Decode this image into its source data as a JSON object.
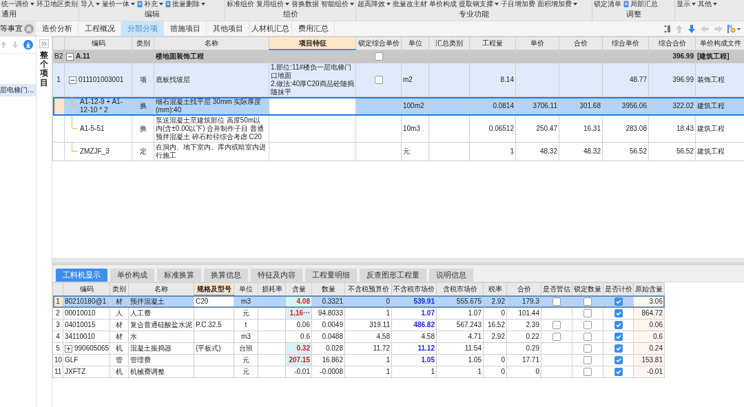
{
  "ribbon": {
    "groups": [
      {
        "label": "通用",
        "buttons": [
          {
            "label": "统一调价",
            "dropdown": true
          },
          {
            "label": "环卫地区类别",
            "dropdown": false
          }
        ]
      },
      {
        "label": "编辑",
        "buttons": [
          {
            "label": "导入",
            "dropdown": true
          },
          {
            "label": "量价一体",
            "dropdown": true
          },
          {
            "label": "补充",
            "dropdown": true,
            "icon": true
          },
          {
            "label": "批量删除",
            "dropdown": true,
            "icon": true
          }
        ]
      },
      {
        "label": "组价",
        "buttons": [
          {
            "label": "标准组价",
            "dropdown": false
          },
          {
            "label": "复用组价",
            "dropdown": true
          },
          {
            "label": "替换数据",
            "dropdown": false
          },
          {
            "label": "智能组价",
            "dropdown": true
          }
        ]
      },
      {
        "label": "专业功能",
        "buttons": [
          {
            "label": "超高降效",
            "dropdown": true
          },
          {
            "label": "批量改主材",
            "dropdown": false
          },
          {
            "label": "单价构成",
            "dropdown": false
          },
          {
            "label": "提取钢支撑",
            "dropdown": true
          },
          {
            "label": "子目增加费",
            "dropdown": false
          },
          {
            "label": "面积增加费",
            "dropdown": true
          }
        ]
      },
      {
        "label": "调整",
        "buttons": [
          {
            "label": "锁定清单",
            "dropdown": false
          },
          {
            "label": "局部汇总",
            "dropdown": false,
            "icon": true
          }
        ]
      },
      {
        "buttons": [
          {
            "label": "显示",
            "dropdown": true
          },
          {
            "label": "其他",
            "dropdown": true
          }
        ]
      }
    ]
  },
  "sidebar": {
    "title": "等事宜",
    "items": [
      {
        "label": "层电梯门...",
        "selected": true
      }
    ]
  },
  "project_strip": {
    "label": "整个项目"
  },
  "tabs": [
    {
      "label": "造价分析",
      "selected": false
    },
    {
      "label": "工程概况",
      "selected": false
    },
    {
      "label": "分部分项",
      "selected": true
    },
    {
      "label": "措施项目",
      "selected": false
    },
    {
      "label": "其他项目",
      "selected": false
    },
    {
      "label": "人材机汇总",
      "selected": false
    },
    {
      "label": "费用汇总",
      "selected": false
    }
  ],
  "items_table": {
    "columns": [
      {
        "label": "编码",
        "selected": false
      },
      {
        "label": "类别",
        "selected": false
      },
      {
        "label": "名称",
        "selected": false
      },
      {
        "label": "项目特征",
        "selected": true
      },
      {
        "label": "锁定综合单价",
        "selected": false
      },
      {
        "label": "单位",
        "selected": false
      },
      {
        "label": "汇总类别",
        "selected": false
      },
      {
        "label": "工程量",
        "selected": false
      },
      {
        "label": "单价",
        "selected": false
      },
      {
        "label": "合价",
        "selected": false
      },
      {
        "label": "综合单价",
        "selected": false
      },
      {
        "label": "综合合价",
        "selected": false
      },
      {
        "label": "单价构成文件",
        "selected": false
      }
    ],
    "rows": [
      {
        "kind": "section",
        "number": "B2",
        "code": "A.11",
        "name": "楼地面装饰工程",
        "locked": false,
        "expanded": true,
        "selected": false,
        "comp_total": "396.99",
        "file": "[建筑工程]",
        "children": [
          {
            "kind": "item",
            "number": "1",
            "code": "011101003001",
            "type": "项",
            "name": "底板找坡层",
            "features": [
              "1.部位:11#楼负一层电梯门口地面",
              "2.做法:40厚C20商品砼随捣随抹平"
            ],
            "locked": false,
            "expanded": true,
            "selected": false,
            "unit": "m2",
            "quantity": "8.14",
            "comp_unit_price": "48.77",
            "comp_total": "396.99",
            "file": "装饰工程",
            "children": [
              {
                "kind": "sub",
                "code": "A1-12-9 + A1-12-10 * 2",
                "type": "换",
                "name": "细石混凝土找平层 30mm  实际厚度(mm):40",
                "selected": true,
                "unit": "100m2",
                "quantity": "0.0814",
                "unit_price": "3706.11",
                "price": "301.68",
                "comp_unit_price": "3956.06",
                "comp_total": "322.02",
                "file": "建筑工程"
              },
              {
                "kind": "sub",
                "code": "A1-5-51",
                "type": "换",
                "name": "泵送混凝土至建筑部位 高度50m以内(含±0.00以下)  合并制作子目 普通预拌混凝土 碎石粒径综合考虑 C20",
                "selected": false,
                "unit": "10m3",
                "quantity": "0.06512",
                "unit_price": "250.47",
                "price": "16.31",
                "comp_unit_price": "283.08",
                "comp_total": "18.43",
                "file": "建筑工程"
              },
              {
                "kind": "sub",
                "code": "ZMZJF_3",
                "type": "定",
                "name": "在洞内、地下室内、库内或暗室内进行施工",
                "selected": false,
                "unit": "元",
                "quantity": "1",
                "unit_price": "48.32",
                "price": "48.32",
                "comp_unit_price": "56.52",
                "comp_total": "56.52",
                "file": "建筑工程"
              }
            ]
          }
        ]
      }
    ]
  },
  "detail_tabs": [
    {
      "label": "工料机显示",
      "selected": true
    },
    {
      "label": "单价构成",
      "selected": false
    },
    {
      "label": "标准换算",
      "selected": false
    },
    {
      "label": "换算信息",
      "selected": false
    },
    {
      "label": "特征及内容",
      "selected": false
    },
    {
      "label": "工程量明细",
      "selected": false
    },
    {
      "label": "反查图形工程量",
      "selected": false
    },
    {
      "label": "说明信息",
      "selected": false
    }
  ],
  "resources_table": {
    "columns": [
      {
        "label": "编码",
        "selected": false
      },
      {
        "label": "类别",
        "selected": false
      },
      {
        "label": "名称",
        "selected": false
      },
      {
        "label": "规格及型号",
        "selected": true
      },
      {
        "label": "单位",
        "selected": false
      },
      {
        "label": "损耗率",
        "selected": false
      },
      {
        "label": "含量",
        "selected": false
      },
      {
        "label": "数量",
        "selected": false
      },
      {
        "label": "不含税预算价",
        "selected": false
      },
      {
        "label": "不含税市场价",
        "selected": false
      },
      {
        "label": "含税市场价",
        "selected": false
      },
      {
        "label": "税率",
        "selected": false
      },
      {
        "label": "合价",
        "selected": false
      },
      {
        "label": "是否暂估",
        "selected": false
      },
      {
        "label": "锁定数量",
        "selected": false
      },
      {
        "label": "是否计价",
        "selected": false
      },
      {
        "label": "原始含量",
        "selected": false
      }
    ],
    "rows": [
      {
        "number": "1",
        "code": "80210180@1",
        "type": "材",
        "name": "预拌混凝土",
        "spec": "C20",
        "unit": "m3",
        "content": "4.08",
        "content_modified": true,
        "quantity": "0.3321",
        "budget_price": "0",
        "market_price": "539.91",
        "market_modified": true,
        "tax_market_price": "555.675",
        "tax_rate": "2.92",
        "total": "179.3",
        "provisional": false,
        "lock_quantity": false,
        "priced": true,
        "original_content": "3.06",
        "selected": true
      },
      {
        "number": "2",
        "code": "00010010",
        "type": "人",
        "name": "人工费",
        "unit": "元",
        "content": "1,16···",
        "content_modified": true,
        "quantity": "94.8033",
        "budget_price": "1",
        "market_price": "1.07",
        "market_modified": true,
        "tax_market_price": "1.07",
        "tax_rate": "0",
        "total": "101.44",
        "lock_quantity": false,
        "priced": true,
        "original_content": "864.72",
        "selected": false
      },
      {
        "number": "3",
        "code": "04010015",
        "type": "材",
        "name": "复合普通硅酸盐水泥",
        "spec": "P.C 32.5",
        "unit": "t",
        "content": "0.06",
        "content_modified": false,
        "quantity": "0.0049",
        "budget_price": "319.11",
        "market_price": "486.82",
        "market_modified": true,
        "tax_market_price": "567.243",
        "tax_rate": "16.52",
        "total": "2.39",
        "provisional": false,
        "lock_quantity": false,
        "priced": true,
        "original_content": "0.06",
        "selected": false
      },
      {
        "number": "4",
        "code": "34110010",
        "type": "材",
        "name": "水",
        "unit": "m3",
        "content": "0.6",
        "content_modified": false,
        "quantity": "0.0488",
        "budget_price": "4.58",
        "market_price": "4.58",
        "market_modified": false,
        "tax_market_price": "4.71",
        "tax_rate": "2.92",
        "total": "0.22",
        "provisional": false,
        "lock_quantity": false,
        "priced": true,
        "original_content": "0.6",
        "selected": false
      },
      {
        "number": "5",
        "expandable": true,
        "code": "990605065",
        "type": "机",
        "name": "混凝土振捣器",
        "spec": "(平板式)",
        "unit": "台班",
        "content": "0.32",
        "content_modified": true,
        "quantity": "0.028",
        "budget_price": "11.72",
        "market_price": "11.12",
        "market_modified": true,
        "tax_market_price": "11.54",
        "total": "0.29",
        "lock_quantity": false,
        "priced": true,
        "original_content": "0.24",
        "selected": false
      },
      {
        "number": "10",
        "code": "GLF",
        "type": "管",
        "name": "管理费",
        "unit": "元",
        "content": "207.15",
        "content_modified": true,
        "quantity": "16.862",
        "budget_price": "1",
        "market_price": "1.05",
        "market_modified": true,
        "tax_market_price": "1.05",
        "tax_rate": "0",
        "total": "17.71",
        "lock_quantity": false,
        "priced": true,
        "original_content": "153.81",
        "selected": false
      },
      {
        "number": "11",
        "code": "JXFTZ",
        "type": "机",
        "name": "机械费调整",
        "unit": "元",
        "content": "-0.01",
        "content_modified": false,
        "quantity": "-0.0008",
        "budget_price": "1",
        "market_price": "1",
        "market_modified": false,
        "tax_market_price": "1",
        "tax_rate": "0",
        "total": "0",
        "lock_quantity": false,
        "priced": true,
        "original_content": "-0.01",
        "selected": false
      }
    ]
  }
}
